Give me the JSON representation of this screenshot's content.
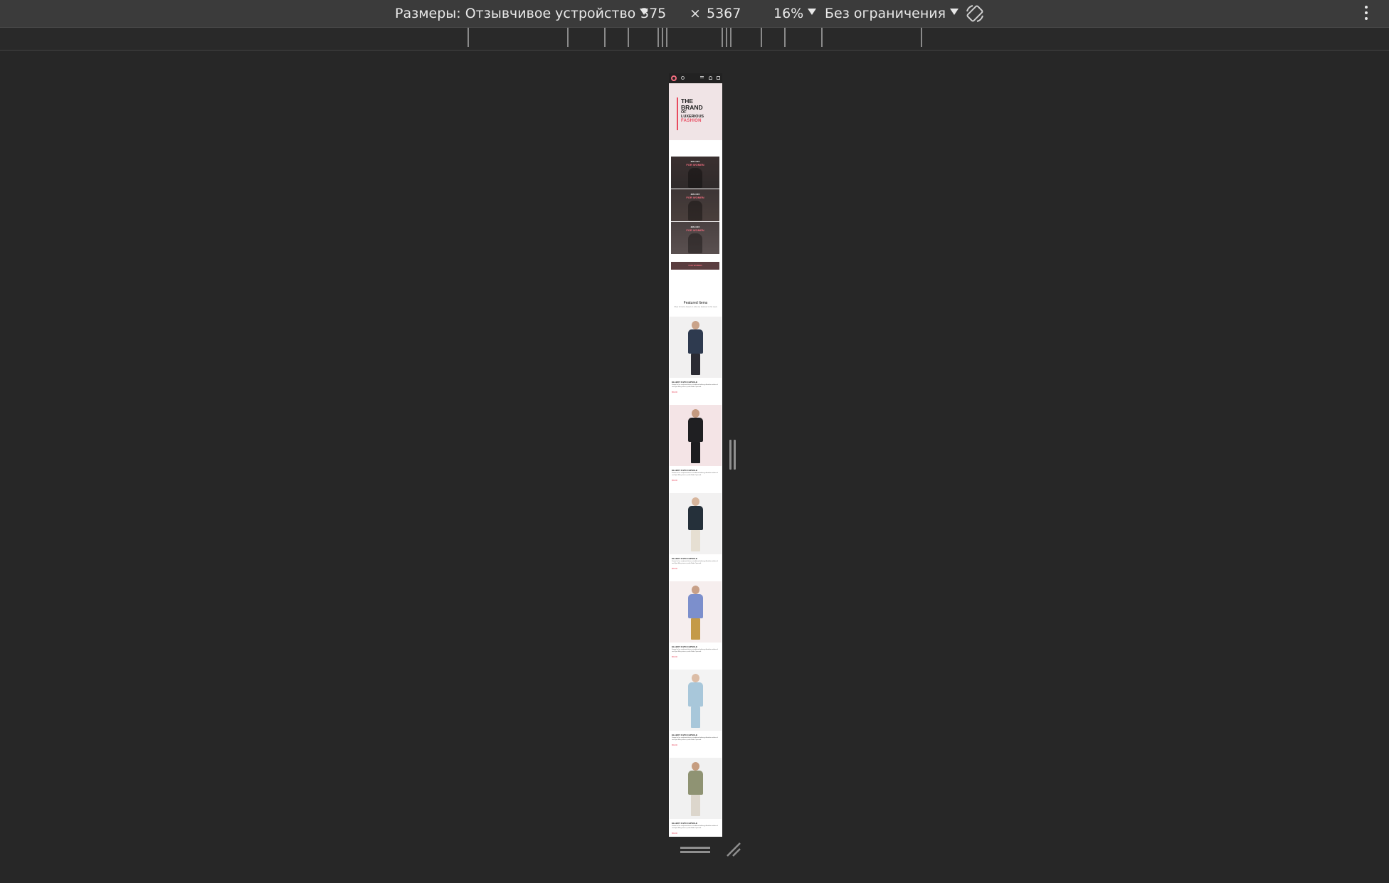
{
  "devtools": {
    "device_label": "Размеры: Отзывчивое устройство",
    "width": "375",
    "times": "×",
    "height": "5367",
    "zoom": "16%",
    "throttling": "Без ограничения"
  },
  "site": {
    "hero": {
      "line1": "THE",
      "line2": "BRAND",
      "line3": "OF",
      "line4": "LUXERIOUS",
      "line5": "FASHION"
    },
    "offers": [
      {
        "top": "30% OFF",
        "bottom": "FOR WOMEN",
        "colors": [
          "#3a3030",
          "#2f2a2a"
        ]
      },
      {
        "top": "30% OFF",
        "bottom": "FOR WOMEN",
        "colors": [
          "#3d3535",
          "#4a3f3c"
        ]
      },
      {
        "top": "30% OFF",
        "bottom": "FOR WOMEN",
        "colors": [
          "#4a4141",
          "#5a5050"
        ]
      }
    ],
    "offer_small": {
      "bottom": "FOR WOMEN"
    },
    "featured": {
      "title": "Featured Items",
      "subtitle": "Shop for items based on what we featured in this week"
    },
    "products": [
      {
        "name": "ELLERY X M'O CAPSULE",
        "desc": "Known for her sculptural takes on traditional tailoring, Australian arbiter of cool Kym Ellery teams up with Moda Operandi.",
        "price": "$52.00",
        "bg": "#f1f0f0",
        "skin": "#c9a38a",
        "top": "#2e3a4f",
        "bottom": "#2b2b33"
      },
      {
        "name": "ELLERY X M'O CAPSULE",
        "desc": "Known for her sculptural takes on traditional tailoring, Australian arbiter of cool Kym Ellery teams up with Moda Operandi.",
        "price": "$52.00",
        "bg": "#f4e4e6",
        "skin": "#c49a80",
        "top": "#1f1f22",
        "bottom": "#1c1c1f"
      },
      {
        "name": "ELLERY X M'O CAPSULE",
        "desc": "Known for her sculptural takes on traditional tailoring, Australian arbiter of cool Kym Ellery teams up with Moda Operandi.",
        "price": "$52.00",
        "bg": "#f2f1f1",
        "skin": "#d7b59c",
        "top": "#25303a",
        "bottom": "#e6dfd2"
      },
      {
        "name": "ELLERY X M'O CAPSULE",
        "desc": "Known for her sculptural takes on traditional tailoring, Australian arbiter of cool Kym Ellery teams up with Moda Operandi.",
        "price": "$52.00",
        "bg": "#f6eeee",
        "skin": "#c8a088",
        "top": "#7c8fcc",
        "bottom": "#c49a48"
      },
      {
        "name": "ELLERY X M'O CAPSULE",
        "desc": "Known for her sculptural takes on traditional tailoring, Australian arbiter of cool Kym Ellery teams up with Moda Operandi.",
        "price": "$52.00",
        "bg": "#f3f3f3",
        "skin": "#dcbda6",
        "top": "#a8c7da",
        "bottom": "#a8c7da"
      },
      {
        "name": "ELLERY X M'O CAPSULE",
        "desc": "Known for her sculptural takes on traditional tailoring, Australian arbiter of cool Kym Ellery teams up with Moda Operandi.",
        "price": "$52.00",
        "bg": "#f1f1f1",
        "skin": "#c69d80",
        "top": "#8f9373",
        "bottom": "#dcd6cc"
      }
    ],
    "accent": "#e84a5f"
  }
}
